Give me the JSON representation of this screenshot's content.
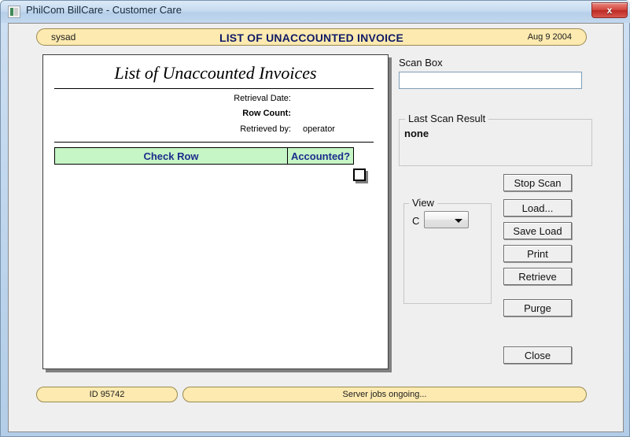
{
  "window": {
    "title": "PhilCom BillCare - Customer Care",
    "icon": "app-icon",
    "close_label": "x"
  },
  "banner": {
    "user": "sysad",
    "title": "LIST OF UNACCOUNTED INVOICE",
    "date": "Aug 9 2004"
  },
  "report": {
    "title": "List of Unaccounted  Invoices",
    "retrieval_date_label": "Retrieval Date:",
    "row_count_label": "Row Count:",
    "retrieved_by_label": "Retrieved by:",
    "retrieved_by_value": "operator",
    "columns": [
      {
        "label": "Check Row"
      },
      {
        "label": "Accounted?"
      }
    ],
    "rows": []
  },
  "scan": {
    "label": "Scan Box",
    "value": "",
    "placeholder": ""
  },
  "last_scan_result": {
    "legend": "Last Scan Result",
    "value": "none"
  },
  "view": {
    "legend": "View",
    "radio_label": "C",
    "selected": "",
    "options": []
  },
  "buttons": {
    "stop_scan": "Stop Scan",
    "load": "Load...",
    "save_load": "Save Load",
    "print": "Print",
    "retrieve": "Retrieve",
    "purge": "Purge",
    "close": "Close"
  },
  "status": {
    "id": "ID 95742",
    "message": "Server jobs ongoing..."
  },
  "colors": {
    "banner_fill": "#fdeab0",
    "banner_text": "#0f1a66",
    "table_header_fill": "#c6f5c6",
    "table_header_text": "#1c2d8c",
    "close_button": "#d2453d",
    "window_chrome": "#bcd4ec"
  }
}
